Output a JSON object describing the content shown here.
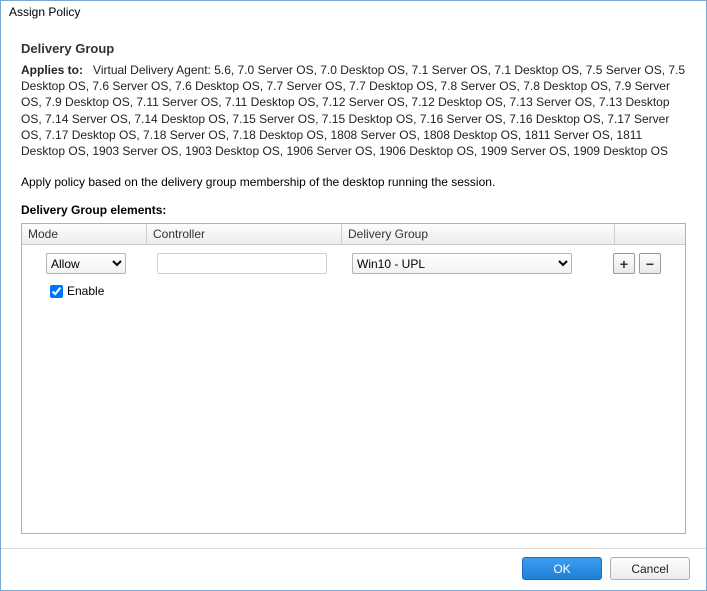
{
  "window": {
    "title": "Assign Policy"
  },
  "section": {
    "heading": "Delivery Group"
  },
  "applies": {
    "label": "Applies to:",
    "text": "Virtual Delivery Agent: 5.6, 7.0 Server OS, 7.0 Desktop OS, 7.1 Server OS, 7.1 Desktop OS, 7.5 Server OS, 7.5 Desktop OS, 7.6 Server OS, 7.6 Desktop OS, 7.7 Server OS, 7.7 Desktop OS, 7.8 Server OS, 7.8 Desktop OS, 7.9 Server OS, 7.9 Desktop OS, 7.11 Server OS, 7.11 Desktop OS, 7.12 Server OS, 7.12 Desktop OS, 7.13 Server OS, 7.13 Desktop OS, 7.14 Server OS, 7.14 Desktop OS, 7.15 Server OS, 7.15 Desktop OS, 7.16 Server OS, 7.16 Desktop OS, 7.17 Server OS, 7.17 Desktop OS, 7.18 Server OS, 7.18 Desktop OS, 1808 Server OS, 1808 Desktop OS, 1811 Server OS, 1811 Desktop OS, 1903 Server OS, 1903 Desktop OS, 1906 Server OS, 1906 Desktop OS, 1909 Server OS, 1909 Desktop OS"
  },
  "description": "Apply policy based on the delivery group membership of the desktop running the session.",
  "elements": {
    "heading": "Delivery Group elements:",
    "columns": {
      "mode": "Mode",
      "controller": "Controller",
      "delivery_group": "Delivery Group"
    },
    "rows": [
      {
        "mode": "Allow",
        "controller": "",
        "delivery_group": "Win10 - UPL"
      }
    ],
    "enable": {
      "label": "Enable",
      "checked": true
    },
    "buttons": {
      "add": "+",
      "remove": "−"
    }
  },
  "footer": {
    "ok": "OK",
    "cancel": "Cancel"
  }
}
